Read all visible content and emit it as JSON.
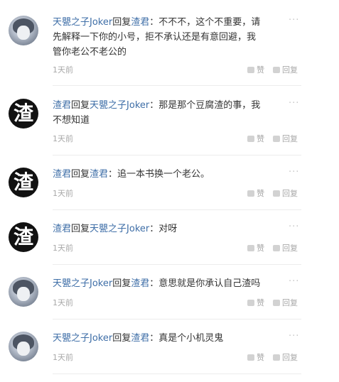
{
  "comments": [
    {
      "avatar": "anime",
      "from": "天甖之子Joker",
      "verb": "回复",
      "to": "渣君",
      "body_lines": [
        "：不不不，这个不重要，请",
        "先解释一下你的小号，拒不承认还是有意回避，我",
        "管你老公不老公的"
      ],
      "time": "1天前",
      "like_label": "赞",
      "reply_label": "回复",
      "more": "···"
    },
    {
      "avatar": "zha",
      "avatar_char": "渣",
      "from": "渣君",
      "verb": "回复",
      "to": "天甖之子Joker",
      "body_lines": [
        "：那是那个豆腐渣的事，我",
        "不想知道"
      ],
      "time": "1天前",
      "like_label": "赞",
      "reply_label": "回复",
      "more": "···"
    },
    {
      "avatar": "zha",
      "avatar_char": "渣",
      "from": "渣君",
      "verb": "回复",
      "to": "渣君",
      "body_lines": [
        "：追一本书换一个老公。"
      ],
      "time": "1天前",
      "like_label": "赞",
      "reply_label": "回复",
      "more": "···"
    },
    {
      "avatar": "zha",
      "avatar_char": "渣",
      "from": "渣君",
      "verb": "回复",
      "to": "天甖之子Joker",
      "body_lines": [
        "：对呀"
      ],
      "time": "1天前",
      "like_label": "赞",
      "reply_label": "回复",
      "more": "···"
    },
    {
      "avatar": "anime",
      "from": "天甖之子Joker",
      "verb": "回复",
      "to": "渣君",
      "body_lines": [
        "：意思就是你承认自己渣吗"
      ],
      "time": "1天前",
      "like_label": "赞",
      "reply_label": "回复",
      "more": "···"
    },
    {
      "avatar": "anime",
      "from": "天甖之子Joker",
      "verb": "回复",
      "to": "渣君",
      "body_lines": [
        "：真是个小机灵鬼"
      ],
      "time": "1天前",
      "like_label": "赞",
      "reply_label": "回复",
      "more": "···"
    }
  ]
}
